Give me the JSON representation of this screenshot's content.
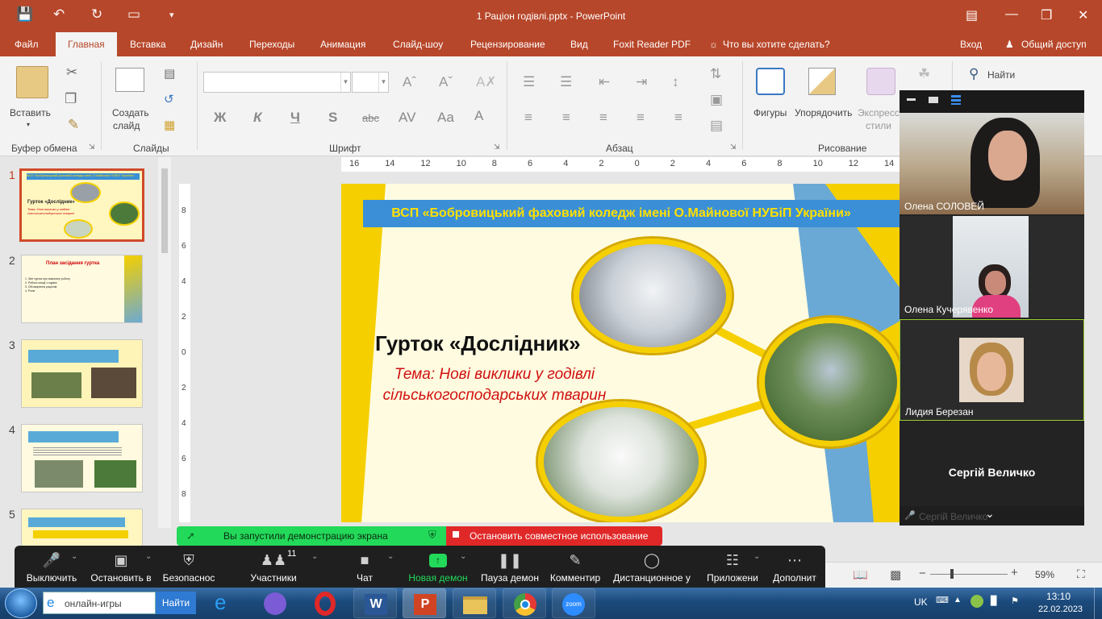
{
  "titlebar": {
    "title": "1 Рацiон годiвлi.pptx - PowerPoint",
    "bg_color": "#b7472a"
  },
  "tabs": {
    "file": "Файл",
    "home": "Главная",
    "insert": "Вставка",
    "design": "Дизайн",
    "transitions": "Переходы",
    "animation": "Анимация",
    "slideshow": "Слайд-шоу",
    "review": "Рецензирование",
    "view": "Вид",
    "foxit": "Foxit Reader PDF",
    "tell_me": "Что вы хотите сделать?",
    "signin": "Вход",
    "share": "Общий доступ"
  },
  "ribbon": {
    "paste": "Вставить",
    "clipboard_group": "Буфер обмена",
    "new_slide_1": "Создать",
    "new_slide_2": "слайд",
    "slides_group": "Слайды",
    "font_group": "Шрифт",
    "bold": "Ж",
    "italic": "К",
    "underline": "Ч",
    "strike": "S",
    "abc": "abc",
    "paragraph_group": "Абзац",
    "shapes": "Фигуры",
    "arrange": "Упорядочить",
    "styles_1": "Экспресс",
    "styles_2": "стили",
    "drawing_group": "Рисование",
    "find": "Найти"
  },
  "ruler": {
    "labels": [
      "16",
      "14",
      "12",
      "10",
      "8",
      "6",
      "4",
      "2",
      "0",
      "2",
      "4",
      "6",
      "8",
      "10",
      "12",
      "14"
    ],
    "vlabels": [
      "8",
      "6",
      "4",
      "2",
      "0",
      "2",
      "4",
      "6",
      "8"
    ]
  },
  "thumbnails": [
    {
      "num": "1",
      "title": "Гурток «Дослідник»",
      "sub": "Тема: Нові виклики у годівлі сільськогосподарських тварин",
      "header": "ВСП «Бобровицький фаховий коледж імені О.Майнової НУБіП України»"
    },
    {
      "num": "2",
      "title": "План засідання гуртка",
      "l1": "1. Звіт гуртка про виконану роботу",
      "l2": "2. Робота секції з годівлі",
      "l3": "3. Обговорення раціонів",
      "l4": "4. Різне"
    },
    {
      "num": "3"
    },
    {
      "num": "4"
    },
    {
      "num": "5"
    }
  ],
  "slide": {
    "header": "ВСП «Бобровицький фаховий коледж імені О.Майнової НУБіП України»",
    "title": "Гурток «Дослідник»",
    "subtitle_1": "Тема: Нові виклики у годівлі",
    "subtitle_2": "сільськогосподарських тварин"
  },
  "zoom": {
    "participants": [
      {
        "name": "Олена СОЛОВЕЙ"
      },
      {
        "name": "Олена Кучерявенко"
      },
      {
        "name": "Лидия Березан"
      },
      {
        "name": "Сергій Величко"
      }
    ],
    "bottom_name": "Сергій Величко",
    "share_notice": "Вы запустили демонстрацию экрана",
    "stop_share": "Остановить совместное использование",
    "toolbar": {
      "mute": "Выключить",
      "video": "Остановить в",
      "security": "Безопаснос",
      "participants": "Участники",
      "participants_count": "11",
      "chat": "Чат",
      "new_share": "Новая демон",
      "pause": "Пауза демон",
      "annotate": "Комментир",
      "remote": "Дистанционное у",
      "apps": "Приложени",
      "more": "Дополнит"
    }
  },
  "statusbar": {
    "zoom_level": "59%"
  },
  "taskbar": {
    "search_text": "онлайн-игры",
    "search_button": "Найти",
    "lang": "UK",
    "time": "13:10",
    "date": "22.02.2023",
    "zoom_app": "zoom"
  }
}
